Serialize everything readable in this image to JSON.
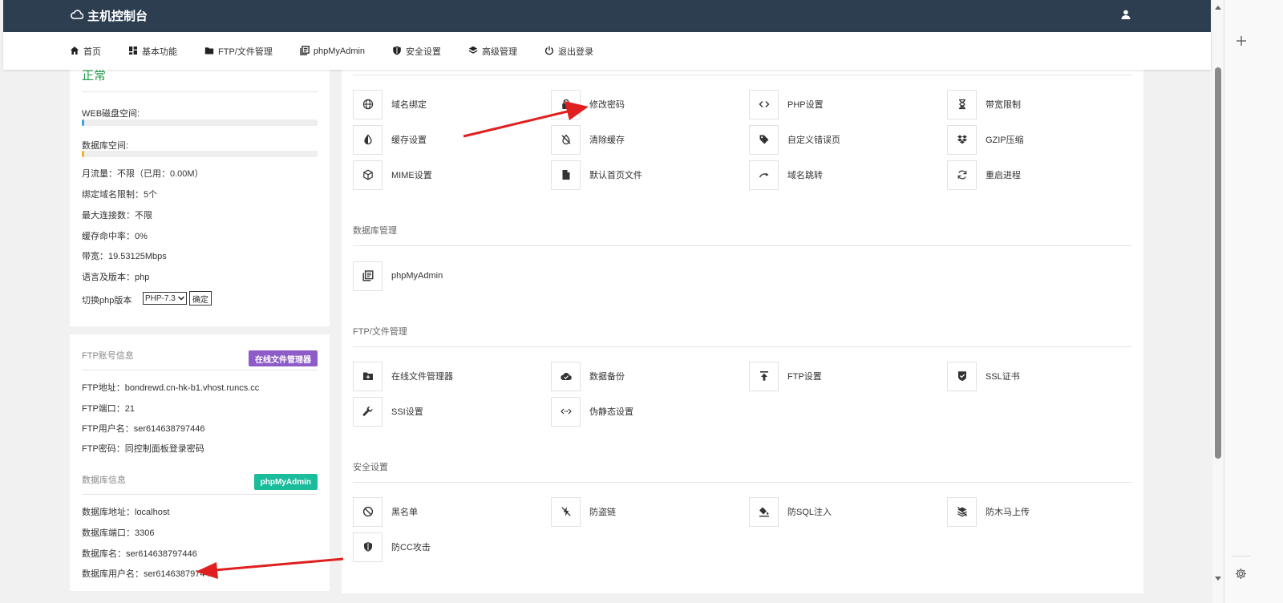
{
  "app": {
    "title": "主机控制台"
  },
  "nav": [
    {
      "label": "首页",
      "icon": "home-icon"
    },
    {
      "label": "基本功能",
      "icon": "grid-icon"
    },
    {
      "label": "FTP/文件管理",
      "icon": "folder-icon"
    },
    {
      "label": "phpMyAdmin",
      "icon": "book-icon"
    },
    {
      "label": "安全设置",
      "icon": "shield-icon"
    },
    {
      "label": "高级管理",
      "icon": "layers-icon"
    },
    {
      "label": "退出登录",
      "icon": "power-icon"
    }
  ],
  "status": {
    "state": "正常",
    "web_disk_label": "WEB磁盘空间:",
    "web_disk_pct": 1,
    "db_space_label": "数据库空间:",
    "db_space_pct": 1,
    "lines": [
      "月流量：不限（已用：0.00M）",
      "绑定域名限制：5个",
      "最大连接数：不限",
      "缓存命中率：0%",
      "带宽：19.53125Mbps",
      "语言及版本：php"
    ],
    "php_switch_label": "切换php版本",
    "php_selected": "PHP-7.3",
    "ok_label": "确定"
  },
  "ftp": {
    "header": "FTP账号信息",
    "button": "在线文件管理器",
    "lines": [
      "FTP地址：bondrewd.cn-hk-b1.vhost.runcs.cc",
      "FTP端口：21",
      "FTP用户名：ser614638797446",
      "FTP密码：同控制面板登录密码"
    ]
  },
  "db": {
    "header": "数据库信息",
    "button": "phpMyAdmin",
    "lines": [
      "数据库地址：localhost",
      "数据库端口：3306",
      "数据库名：ser614638797446",
      "数据库用户名：ser614638797446"
    ]
  },
  "sections": {
    "basic": {
      "items": [
        {
          "label": "域名绑定",
          "icon": "globe-icon"
        },
        {
          "label": "修改密码",
          "icon": "lock-icon"
        },
        {
          "label": "PHP设置",
          "icon": "code-icon"
        },
        {
          "label": "带宽限制",
          "icon": "hourglass-icon"
        },
        {
          "label": "缓存设置",
          "icon": "contrast-icon"
        },
        {
          "label": "清除缓存",
          "icon": "no-drop-icon"
        },
        {
          "label": "自定义错误页",
          "icon": "tag-icon"
        },
        {
          "label": "GZIP压缩",
          "icon": "dropbox-icon"
        },
        {
          "label": "MIME设置",
          "icon": "cube-icon"
        },
        {
          "label": "默认首页文件",
          "icon": "file-icon"
        },
        {
          "label": "域名跳转",
          "icon": "redirect-icon"
        },
        {
          "label": "重启进程",
          "icon": "refresh-icon"
        }
      ]
    },
    "database": {
      "title": "数据库管理",
      "items": [
        {
          "label": "phpMyAdmin",
          "icon": "book-icon"
        }
      ]
    },
    "ftp": {
      "title": "FTP/文件管理",
      "items": [
        {
          "label": "在线文件管理器",
          "icon": "folder-plus-icon"
        },
        {
          "label": "数据备份",
          "icon": "cloud-check-icon"
        },
        {
          "label": "FTP设置",
          "icon": "upload-icon"
        },
        {
          "label": "SSL证书",
          "icon": "check-shield-icon"
        },
        {
          "label": "SSI设置",
          "icon": "wrench-icon"
        },
        {
          "label": "伪静态设置",
          "icon": "code-dots-icon"
        }
      ]
    },
    "security": {
      "title": "安全设置",
      "items": [
        {
          "label": "黑名单",
          "icon": "ban-icon"
        },
        {
          "label": "防盗链",
          "icon": "bolt-off-icon"
        },
        {
          "label": "防SQL注入",
          "icon": "paint-bucket-icon"
        },
        {
          "label": "防木马上传",
          "icon": "layers-off-icon"
        },
        {
          "label": "防CC攻击",
          "icon": "shield-half-icon"
        }
      ]
    }
  },
  "colors": {
    "topbar": "#2c3e50",
    "status_ok": "#1e9e4a",
    "web_disk_bar": "#3aa6dc",
    "db_bar": "#f0b429",
    "ftp_button": "#8e5cc9",
    "db_button": "#1abc9c",
    "arrow": "#e02020"
  }
}
